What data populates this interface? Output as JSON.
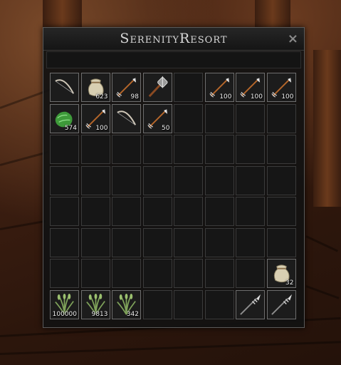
{
  "window": {
    "title": "SerenityResort",
    "close_label": "×"
  },
  "inventory": {
    "columns": 8,
    "rows": 8,
    "slots": [
      {
        "icon": "bow-icon",
        "qty": ""
      },
      {
        "icon": "sack-icon",
        "qty": "623"
      },
      {
        "icon": "arrow-icon",
        "qty": "98"
      },
      {
        "icon": "mace-icon",
        "qty": ""
      },
      null,
      {
        "icon": "arrow-icon",
        "qty": "100"
      },
      {
        "icon": "arrow-icon",
        "qty": "100"
      },
      {
        "icon": "arrow-icon",
        "qty": "100"
      },
      {
        "icon": "herb-icon",
        "qty": "574"
      },
      {
        "icon": "arrow-icon",
        "qty": "100"
      },
      {
        "icon": "bow-icon",
        "qty": ""
      },
      {
        "icon": "arrow-icon",
        "qty": "50"
      },
      null,
      null,
      null,
      null,
      null,
      null,
      null,
      null,
      null,
      null,
      null,
      null,
      null,
      null,
      null,
      null,
      null,
      null,
      null,
      null,
      null,
      null,
      null,
      null,
      null,
      null,
      null,
      null,
      null,
      null,
      null,
      null,
      null,
      null,
      null,
      null,
      null,
      null,
      null,
      null,
      null,
      null,
      null,
      {
        "icon": "sack-icon",
        "qty": "32"
      },
      {
        "icon": "grass-icon",
        "qty": "100000"
      },
      {
        "icon": "grass-icon",
        "qty": "9813"
      },
      {
        "icon": "grass-icon",
        "qty": "342"
      },
      null,
      null,
      null,
      {
        "icon": "spear-icon",
        "qty": ""
      },
      {
        "icon": "spear-icon",
        "qty": ""
      }
    ]
  },
  "colors": {
    "panel_border": "#5a5a5a",
    "slot_border": "#3b3b3b",
    "filled_border": "#6e6e6e"
  }
}
